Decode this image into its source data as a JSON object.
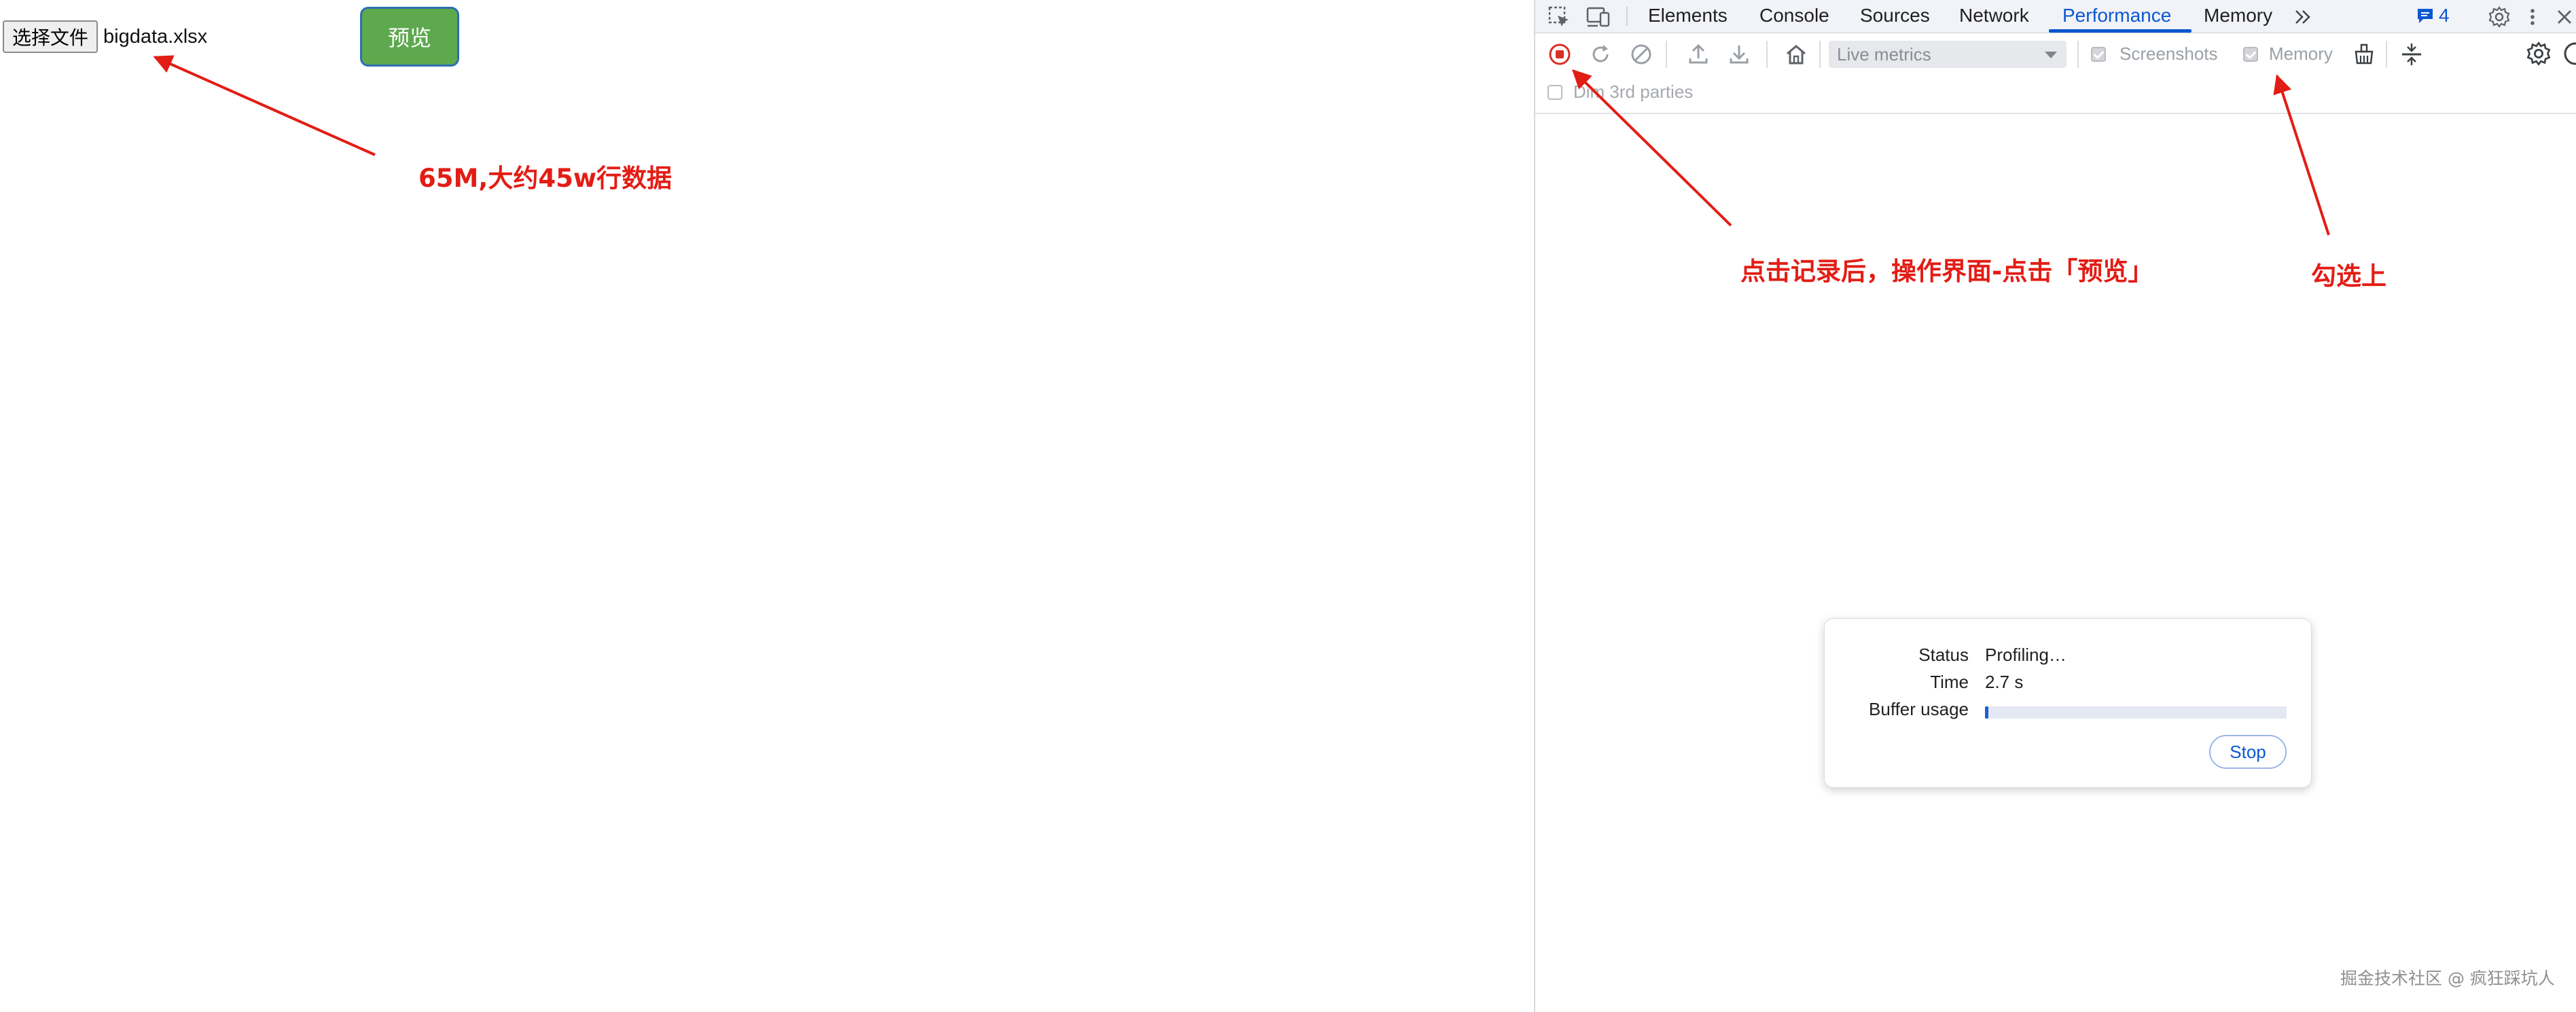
{
  "page": {
    "file_button_label": "选择文件",
    "file_name": "bigdata.xlsx",
    "preview_button_label": "预览",
    "colors": {
      "preview_bg": "#5ea84e",
      "preview_border": "#2d6fb1",
      "annotation": "#e21d15"
    }
  },
  "annotations": {
    "file_size_note": "65M,大约45w行数据",
    "record_note": "点击记录后，操作界面-点击「预览」",
    "check_note": "勾选上"
  },
  "devtools": {
    "tabs": [
      {
        "label": "Elements"
      },
      {
        "label": "Console"
      },
      {
        "label": "Sources"
      },
      {
        "label": "Network"
      },
      {
        "label": "Performance",
        "active": true
      },
      {
        "label": "Memory"
      }
    ],
    "issues_count": "4",
    "toolbar": {
      "live_metrics_label": "Live metrics",
      "screenshots_label": "Screenshots",
      "screenshots_checked": true,
      "memory_label": "Memory",
      "memory_checked": true
    },
    "dim_third_parties_label": "Dim 3rd parties",
    "dim_third_parties_checked": false,
    "status_dialog": {
      "status_label": "Status",
      "status_value": "Profiling…",
      "time_label": "Time",
      "time_value": "2.7 s",
      "buffer_label": "Buffer usage",
      "buffer_fraction": 0.012,
      "stop_label": "Stop"
    },
    "colors": {
      "accent": "#0b57d0",
      "record": "#d93025"
    }
  },
  "watermark": "掘金技术社区 @ 疯狂踩坑人"
}
